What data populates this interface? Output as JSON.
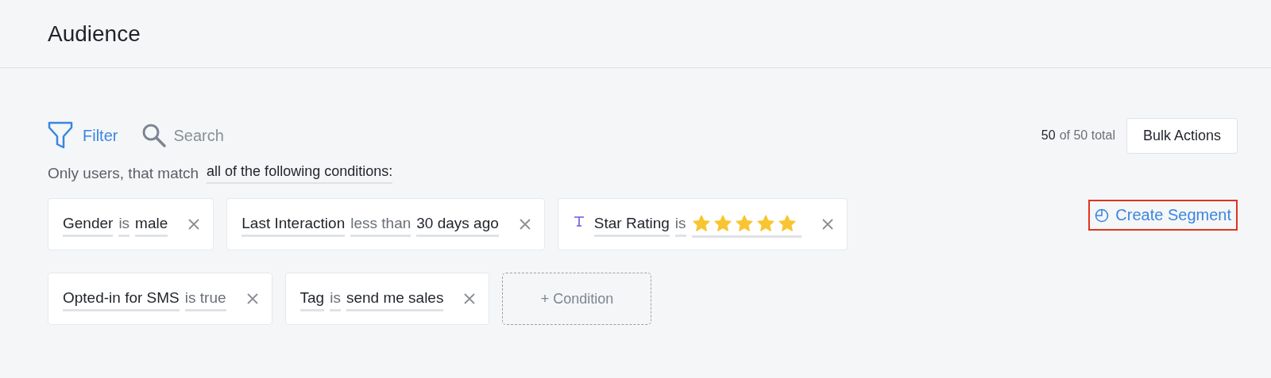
{
  "header": {
    "title": "Audience"
  },
  "toolbar": {
    "filter": "Filter",
    "search": {
      "placeholder": "Search"
    },
    "count": "50",
    "count_rest": "of 50 total",
    "bulk_actions": "Bulk Actions"
  },
  "match": {
    "label": "Only users, that match",
    "mode": "all of the following conditions:"
  },
  "conditions": [
    {
      "kind": "text",
      "field": "Gender",
      "operator": "is",
      "value": "male"
    },
    {
      "kind": "text",
      "field": "Last Interaction",
      "operator": "less than",
      "value": "30 days ago"
    },
    {
      "kind": "stars",
      "field": "Star Rating",
      "operator": "is",
      "stars": 5
    },
    {
      "kind": "text",
      "field": "Opted-in for SMS",
      "operator": "is true"
    },
    {
      "kind": "text",
      "field": "Tag",
      "operator": "is",
      "value": "send me sales"
    }
  ],
  "add_condition": "+ Condition",
  "create_segment": {
    "label": "Create Segment",
    "highlighted": true
  }
}
